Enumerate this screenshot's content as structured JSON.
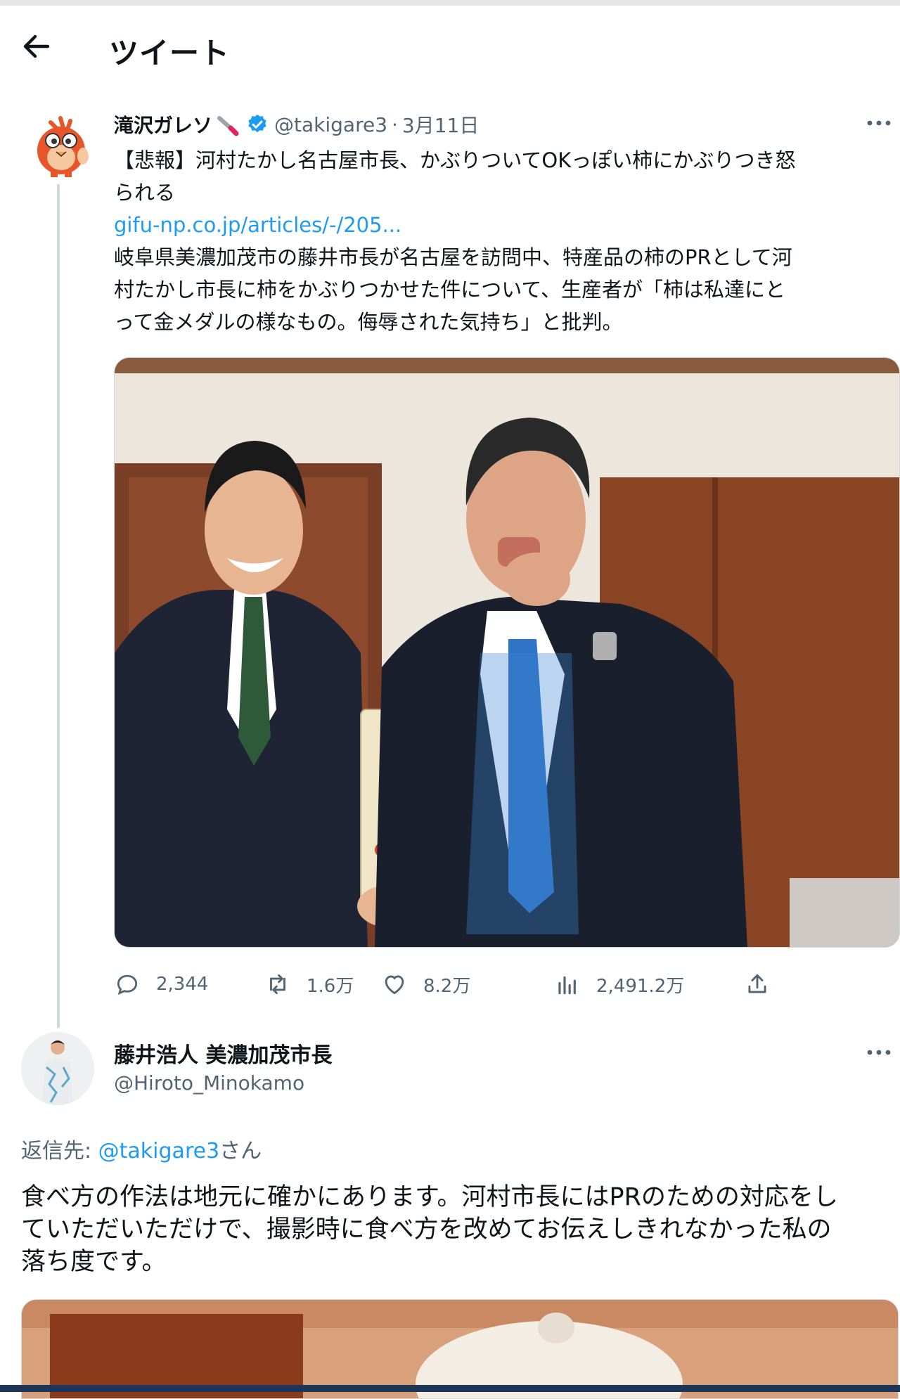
{
  "header": {
    "title": "ツイート"
  },
  "tweet": {
    "author_name": "滝沢ガレソ",
    "handle": "@takigare3",
    "separator": "·",
    "date": "3月11日",
    "text_lines": [
      "【悲報】河村たかし名古屋市長、かぶりついてOKっぽい柿にかぶりつき怒",
      "られる"
    ],
    "link": "gifu-np.co.jp/articles/-/205...",
    "body_lines": [
      "岐阜県美濃加茂市の藤井市長が名古屋を訪問中、特産品の柿のPRとして河",
      "村たかし市長に柿をかぶりつかせた件について、生産者が「柿は私達にと",
      "って金メダルの様なもの。侮辱された気持ち」と批判。"
    ],
    "stats": {
      "replies": "2,344",
      "retweets": "1.6万",
      "likes": "8.2万",
      "views": "2,491.2万"
    }
  },
  "reply": {
    "author_name": "藤井浩人 美濃加茂市長",
    "handle": "@Hiroto_Minokamo",
    "reply_to_prefix": "返信先: ",
    "reply_to_handle": "@takigare3",
    "reply_to_suffix": "さん",
    "text_lines": [
      "食べ方の作法は地元に確かにあります。河村市長にはPRのための対応をし",
      "ていただいただけで、撮影時に食べ方を改めてお伝えしきれなかった私の",
      "落ち度です。"
    ]
  },
  "colors": {
    "link": "#1d9bf0",
    "secondary_text": "#536471",
    "verified": "#1d9bf0"
  },
  "icons": [
    "back-arrow-icon",
    "brush-icon",
    "verified-icon",
    "more-icon",
    "reply-icon",
    "retweet-icon",
    "like-icon",
    "views-icon",
    "share-icon"
  ]
}
